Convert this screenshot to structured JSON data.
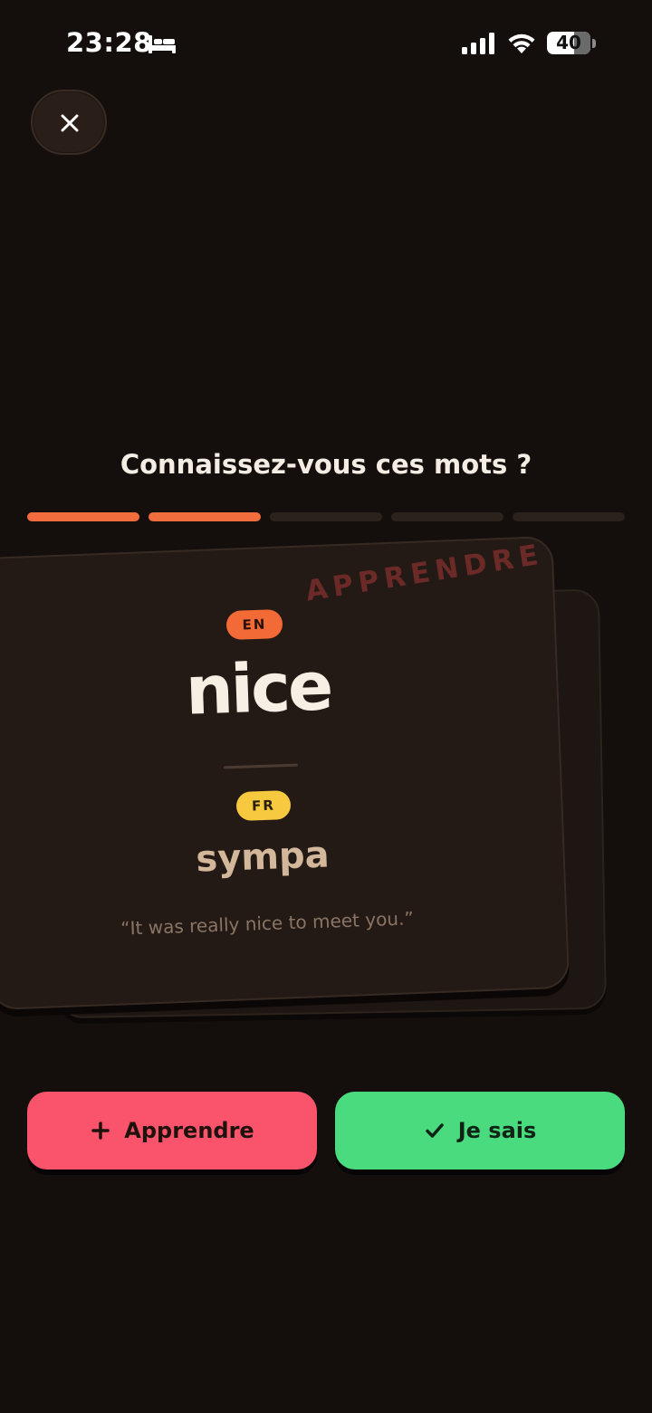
{
  "status_bar": {
    "time": "23:28",
    "battery": "40",
    "battery_level": 0.4
  },
  "header": {
    "close_icon": "close-icon"
  },
  "quiz": {
    "title": "Connaissez-vous ces mots ?",
    "progress": {
      "total_steps": 5,
      "completed_steps": 2
    },
    "card": {
      "stamp": "APPRENDRE",
      "source_lang": "EN",
      "source_word": "nice",
      "target_lang": "FR",
      "target_word": "sympa",
      "example": "“It was really nice to meet you.”"
    }
  },
  "actions": {
    "learn_label": "Apprendre",
    "learn_icon": "plus-icon",
    "know_label": "Je sais",
    "know_icon": "check-icon"
  },
  "colors": {
    "background": "#140f0d",
    "progress_done": "#f26d3d",
    "progress_todo": "#2c221c",
    "en_badge": "#f26a35",
    "fr_badge": "#f7c93f",
    "learn_button": "#fa546d",
    "know_button": "#4adb7f"
  }
}
